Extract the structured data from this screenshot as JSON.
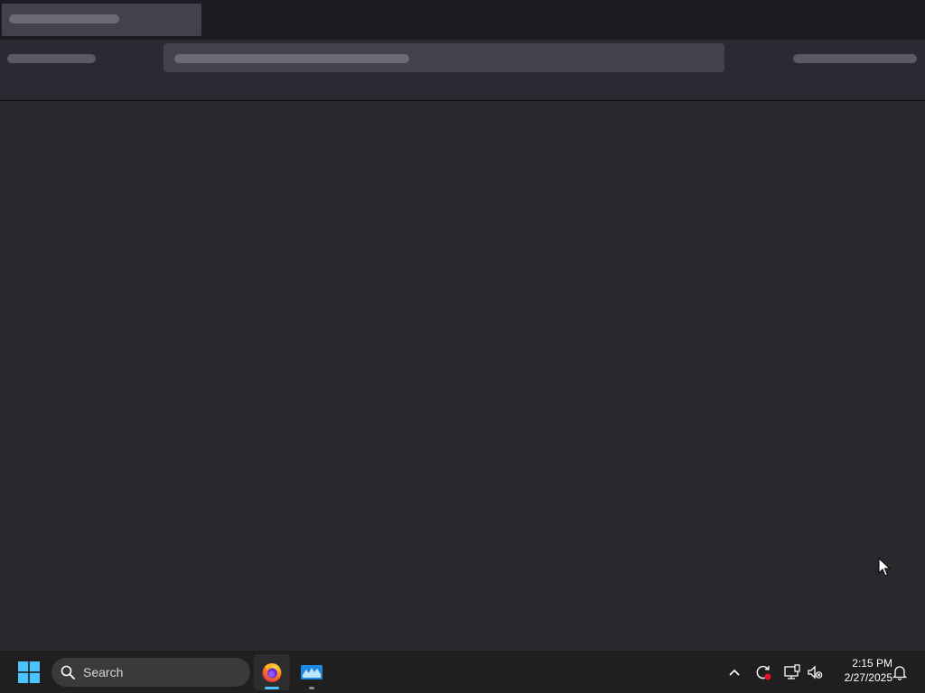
{
  "taskbar": {
    "search_label": "Search",
    "time": "2:15 PM",
    "date": "2/27/2025",
    "accent_color": "#4cc2ff",
    "icons": {
      "start": "windows-logo-icon",
      "search": "search-icon",
      "apps": [
        "firefox-icon",
        "screen-tool-icon"
      ],
      "tray": [
        "chevron-up-icon",
        "sync-icon",
        "network-icon",
        "volume-muted-icon",
        "notification-bell-icon"
      ]
    }
  }
}
